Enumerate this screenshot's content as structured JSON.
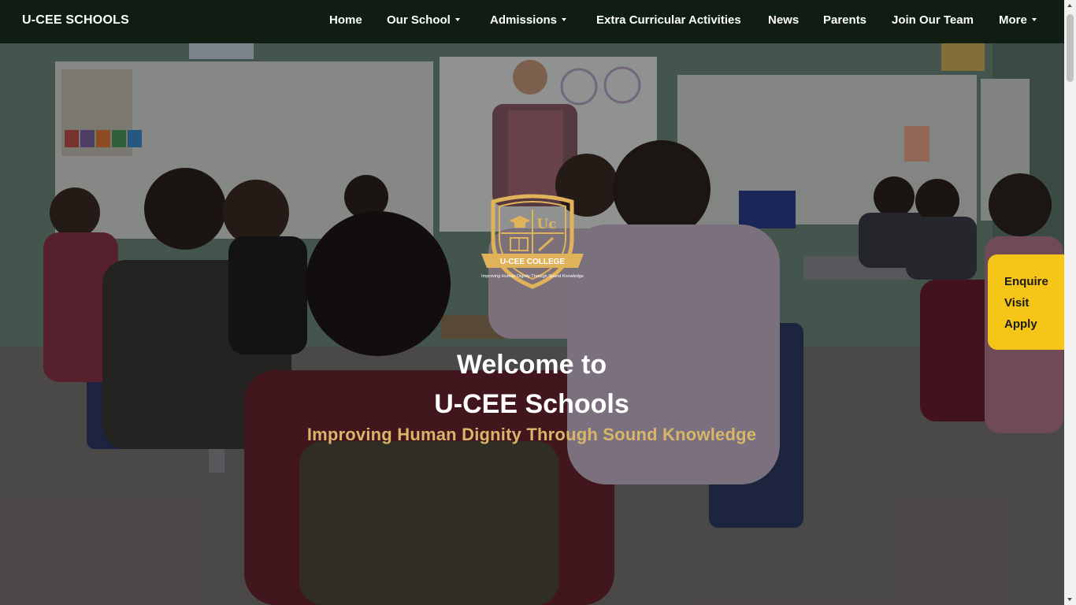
{
  "navbar": {
    "brand": "U-CEE SCHOOLS",
    "items": [
      {
        "label": "Home",
        "has_dropdown": false
      },
      {
        "label": "Our School",
        "has_dropdown": true
      },
      {
        "label": "Admissions",
        "has_dropdown": true
      },
      {
        "label": "Extra Curricular Activities",
        "has_dropdown": false
      },
      {
        "label": "News",
        "has_dropdown": false
      },
      {
        "label": "Parents",
        "has_dropdown": false
      },
      {
        "label": "Join Our Team",
        "has_dropdown": false
      },
      {
        "label": "More",
        "has_dropdown": true
      }
    ]
  },
  "hero": {
    "background_image": "classroom-photo",
    "logo": {
      "initials": "Uc",
      "ribbon_text": "U-CEE COLLEGE",
      "motto": "Improving Human Dignity Through Sound Knowledge"
    },
    "welcome_line1": "Welcome to",
    "welcome_line2": "U-CEE Schools",
    "tagline": "Improving Human Dignity Through Sound Knowledge"
  },
  "side_cta": {
    "links": [
      "Enquire",
      "Visit",
      "Apply"
    ]
  },
  "colors": {
    "navbar_bg": "#0f1d12",
    "accent_gold": "#d9b56a",
    "cta_yellow": "#f5c518",
    "text_white": "#ffffff"
  }
}
